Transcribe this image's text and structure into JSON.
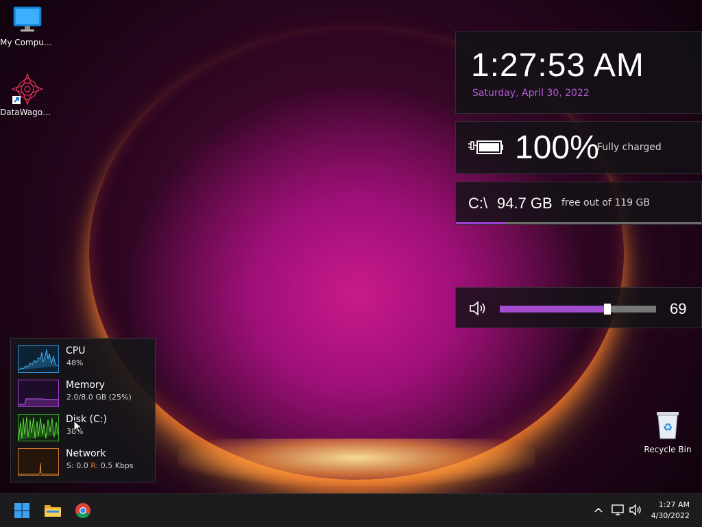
{
  "desktop": {
    "icons": [
      {
        "label": "My Computer"
      },
      {
        "label": "DataWagon..."
      },
      {
        "label": "Recycle Bin"
      }
    ]
  },
  "widgets": {
    "clock": {
      "time": "1:27:53 AM",
      "date": "Saturday, April 30, 2022"
    },
    "battery": {
      "percent": "100%",
      "status": "Fully charged"
    },
    "disk": {
      "drive": "C:\\",
      "free": "94.7 GB",
      "sub": "free out of 119 GB",
      "used_fraction": 0.2
    },
    "volume": {
      "value": "69",
      "level": 0.69
    }
  },
  "perf": {
    "cpu": {
      "name": "CPU",
      "value": "48%"
    },
    "memory": {
      "name": "Memory",
      "value": "2.0/8.0 GB (25%)"
    },
    "disk": {
      "name": "Disk (C:)",
      "value": "38%"
    },
    "network": {
      "name": "Network",
      "send_label": "S:",
      "send_value": "0.0",
      "recv_label": "R:",
      "recv_value": "0.5 Kbps"
    }
  },
  "taskbar": {
    "clock_time": "1:27 AM",
    "clock_date": "4/30/2022"
  },
  "icons": {
    "start": "windows-start-icon",
    "explorer": "file-explorer-icon",
    "chrome": "chrome-icon",
    "tray_chevron": "chevron-up-icon",
    "network": "network-icon",
    "speaker": "speaker-icon"
  },
  "colors": {
    "accent": "#b15ed6",
    "cpu": "#2f8fd6",
    "memory": "#a63bd1",
    "disk": "#3fae2a",
    "network": "#d2782a"
  }
}
